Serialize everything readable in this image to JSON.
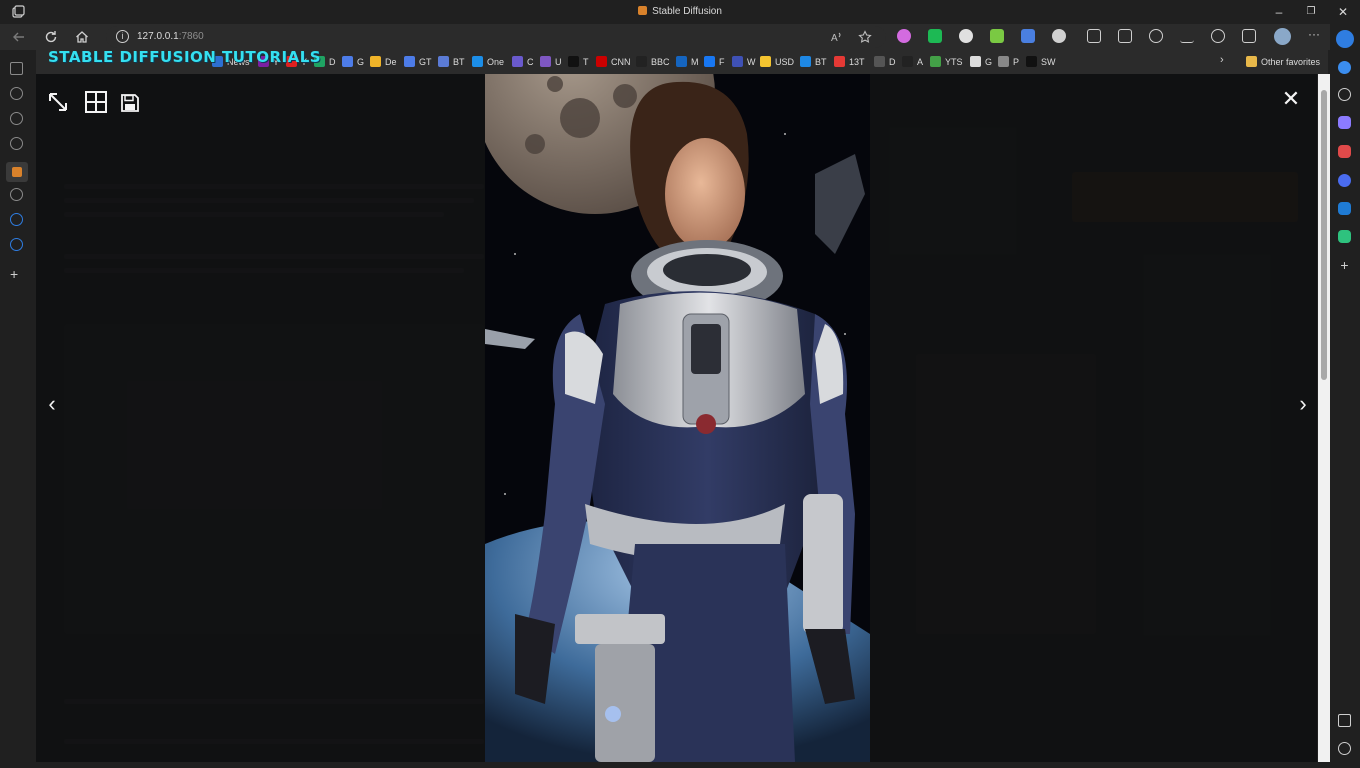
{
  "browser": {
    "window_title": "Stable Diffusion",
    "url_host": "127.0.0.1",
    "url_port": ":7860"
  },
  "watermark": "STABLE DIFFUSION TUTORIALS",
  "bookmarks": [
    {
      "label": "News",
      "color": "#2d6fd1"
    },
    {
      "label": "Y",
      "color": "#7b1fa2"
    },
    {
      "label": "Y",
      "color": "#e02020"
    },
    {
      "label": "D",
      "color": "#1fa463"
    },
    {
      "label": "G",
      "color": "#4d7ce8"
    },
    {
      "label": "De",
      "color": "#f0b429"
    },
    {
      "label": "GT",
      "color": "#4d7ce8"
    },
    {
      "label": "BT",
      "color": "#5b7bd5"
    },
    {
      "label": "One",
      "color": "#1c8ee8"
    },
    {
      "label": "C",
      "color": "#6a5acd"
    },
    {
      "label": "U",
      "color": "#7e57c2"
    },
    {
      "label": "T",
      "color": "#111111"
    },
    {
      "label": "CNN",
      "color": "#cc0000"
    },
    {
      "label": "BBC",
      "color": "#222222"
    },
    {
      "label": "M",
      "color": "#1565c0"
    },
    {
      "label": "F",
      "color": "#1877f2"
    },
    {
      "label": "W",
      "color": "#3f51b5"
    },
    {
      "label": "USD",
      "color": "#f4c430"
    },
    {
      "label": "BT",
      "color": "#1e88e5"
    },
    {
      "label": "13T",
      "color": "#e53935"
    },
    {
      "label": "D",
      "color": "#555555"
    },
    {
      "label": "A",
      "color": "#222222"
    },
    {
      "label": "YTS",
      "color": "#43a047"
    },
    {
      "label": "G",
      "color": "#dddddd"
    },
    {
      "label": "P",
      "color": "#888888"
    },
    {
      "label": "SW",
      "color": "#111111"
    }
  ],
  "other_favorites": "Other favorites",
  "lightbox": {
    "close_glyph": "✕",
    "prev_glyph": "‹",
    "next_glyph": "›"
  }
}
